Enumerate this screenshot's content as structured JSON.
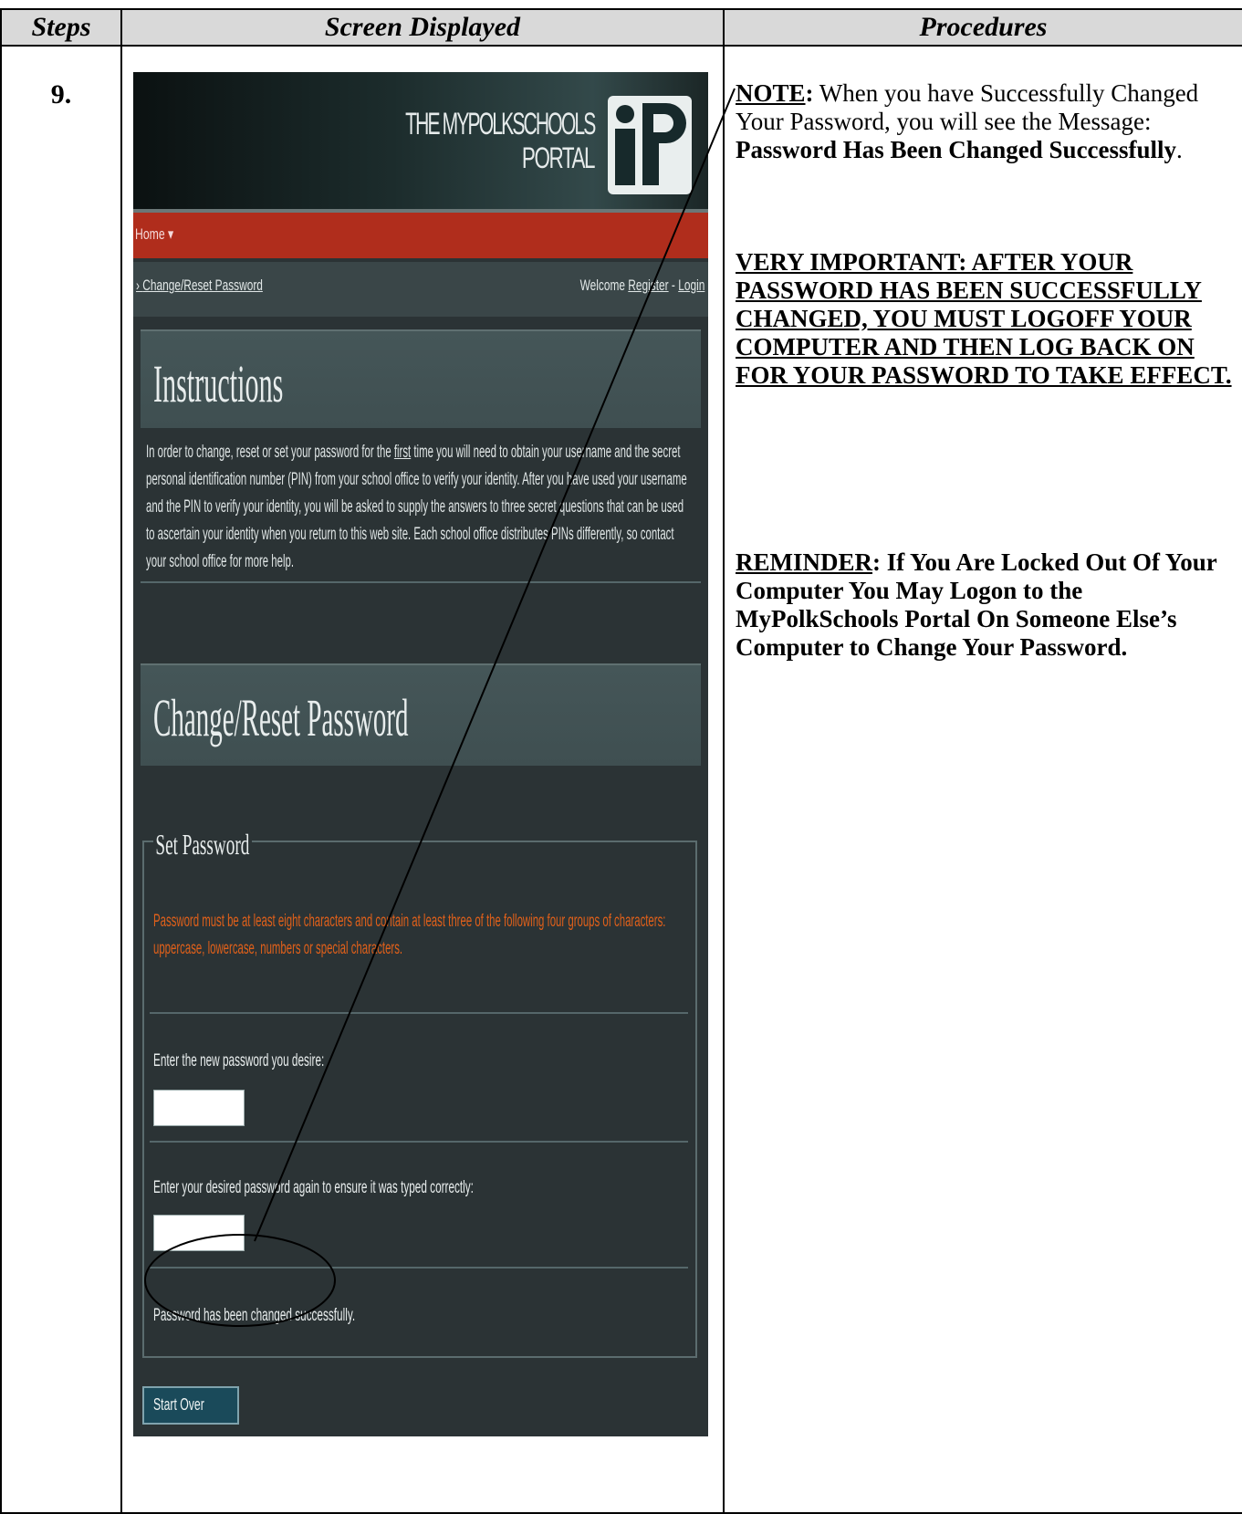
{
  "table": {
    "headers": [
      "Steps",
      "Screen Displayed",
      "Procedures"
    ],
    "step": "9."
  },
  "screen": {
    "brand_line1": "THE MYPOLKSCHOOLS",
    "brand_line2": "PORTAL",
    "nav_home": "Home",
    "breadcrumb": "Change/Reset Password",
    "welcome": "Welcome",
    "register": "Register",
    "separator": "-",
    "login": "Login",
    "instructions_title": "Instructions",
    "instructions_p1": "In order to change, reset or set your password for the ",
    "instructions_first": "first",
    "instructions_p2": " time you will need to obtain your username and the secret personal identification number (PIN) from your school office to verify your identity. After you have used your username and the PIN to verify your identity, you will be asked to supply the answers to three secret questions that can be used to ascertain your identity when you return to this web site.  Each school office distributes PINs differently, so contact your school office for more help.",
    "change_title": "Change/Reset Password",
    "legend": "Set Password",
    "requirement": "Password must be at least eight characters and contain at least three of the following four groups of characters: uppercase, lowercase, numbers or special characters.",
    "label_new": "Enter the new password you desire:",
    "label_confirm": "Enter your desired password again to ensure it was typed correctly:",
    "success": "Password has been changed successfully.",
    "start_over": "Start Over"
  },
  "procedures": {
    "note_label": "NOTE",
    "note_colon": ":",
    "note_text": "  When you have Successfully Changed Your Password, you will see the Message: ",
    "note_bold": "Password Has Been Changed Successfully",
    "note_end": ".",
    "important": "VERY IMPORTANT:  AFTER YOUR PASSWORD HAS BEEN SUCCESSFULLY CHANGED, YOU MUST LOGOFF YOUR COMPUTER AND THEN LOG BACK ON FOR YOUR PASSWORD TO TAKE EFFECT.",
    "reminder_label": "REMINDER",
    "reminder_text": ":  If You Are Locked Out Of Your Computer You May Logon to the  MyPolkSchools Portal On Someone Else’s Computer to Change Your Password."
  },
  "colors": {
    "nav_red": "#b02d1c",
    "orange_text": "#e0601a",
    "screen_bg": "#2b3335"
  }
}
